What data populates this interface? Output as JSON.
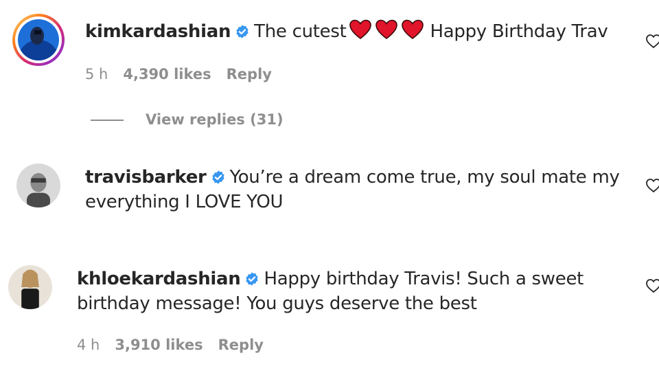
{
  "comments": [
    {
      "username": "kimkardashian",
      "text_before_hearts": "The cutest",
      "hearts": 3,
      "text_after_hearts": "Happy Birthday Trav",
      "time": "5 h",
      "likes": "4,390 likes",
      "reply": "Reply",
      "view_replies": "View replies (31)",
      "has_story_ring": true
    },
    {
      "username": "travisbarker",
      "text_line1": "You’re a dream come true, my soul mate my",
      "text_line2": "everything I LOVE YOU"
    },
    {
      "username": "khloekardashian",
      "text_line1": "Happy birthday Travis! Such a sweet",
      "text_line2": "birthday message! You guys deserve the best",
      "time": "4 h",
      "likes": "3,910 likes",
      "reply": "Reply"
    }
  ],
  "colors": {
    "verified_blue": "#3897f0",
    "heart_red": "#e0142a",
    "meta_gray": "#8e8e8e",
    "text_dark": "#262626"
  },
  "icons": {
    "verified": "verified-badge-icon",
    "like": "heart-outline-icon",
    "heart_emoji": "red-heart-emoji-icon"
  }
}
